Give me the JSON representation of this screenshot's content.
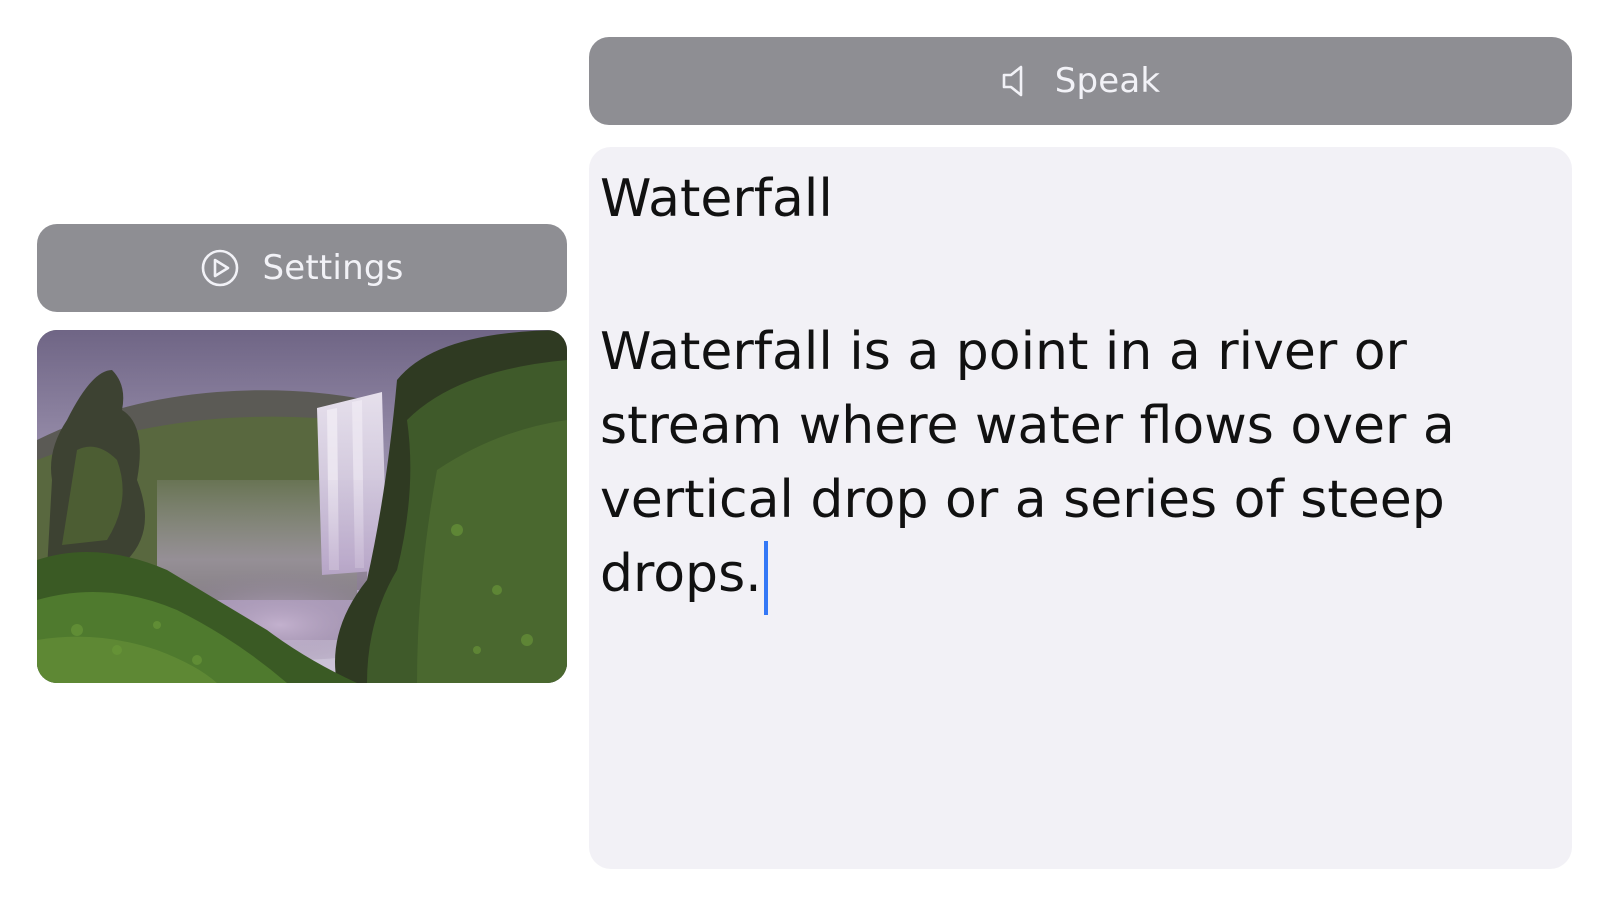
{
  "toolbar": {
    "speak_label": "Speak",
    "speak_icon": "speaker-icon",
    "settings_label": "Settings",
    "settings_icon": "play-circle-icon"
  },
  "document": {
    "title": "Waterfall",
    "body": "Waterfall is a point in a river or stream where water flows over a vertical drop or a series of steep drops."
  },
  "colors": {
    "button_bg": "#8e8e93",
    "button_text": "#f2f2f7",
    "panel_bg": "#f2f1f6",
    "caret": "#3478f6"
  }
}
